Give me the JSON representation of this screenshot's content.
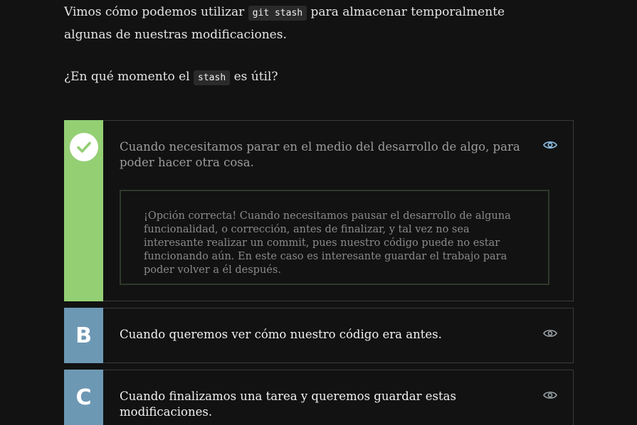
{
  "intro": {
    "line1_pre": "Vimos cómo podemos utilizar ",
    "line1_code": "git stash",
    "line1_post": " para almacenar temporalmente algunas de nuestras modificaciones.",
    "question_pre": "¿En qué momento el ",
    "question_code": "stash",
    "question_post": " es útil?"
  },
  "options": [
    {
      "marker": "check",
      "text": "Cuando necesitamos parar en el medio del desarrollo de algo, para poder hacer otra cosa.",
      "selected": true,
      "correct": true,
      "feedback": "¡Opción correcta! Cuando necesitamos pausar el desarrollo de alguna funcionalidad, o corrección, antes de finalizar, y tal vez no sea interesante realizar un commit, pues nuestro código puede no estar funcionando aún. En este caso es interesante guardar el trabajo para poder volver a él después."
    },
    {
      "marker": "B",
      "text": "Cuando queremos ver cómo nuestro código era antes.",
      "selected": false
    },
    {
      "marker": "C",
      "text": "Cuando finalizamos una tarea y queremos guardar estas modificaciones.",
      "selected": false
    }
  ],
  "icons": {
    "correct": "check-icon",
    "toggle": "eye-icon"
  },
  "colors": {
    "background": "#121212",
    "correct_marker": "#94cf74",
    "option_marker": "#6d98b4",
    "eye_selected": "#8bbbe0",
    "eye_default": "#9aa3a8"
  }
}
